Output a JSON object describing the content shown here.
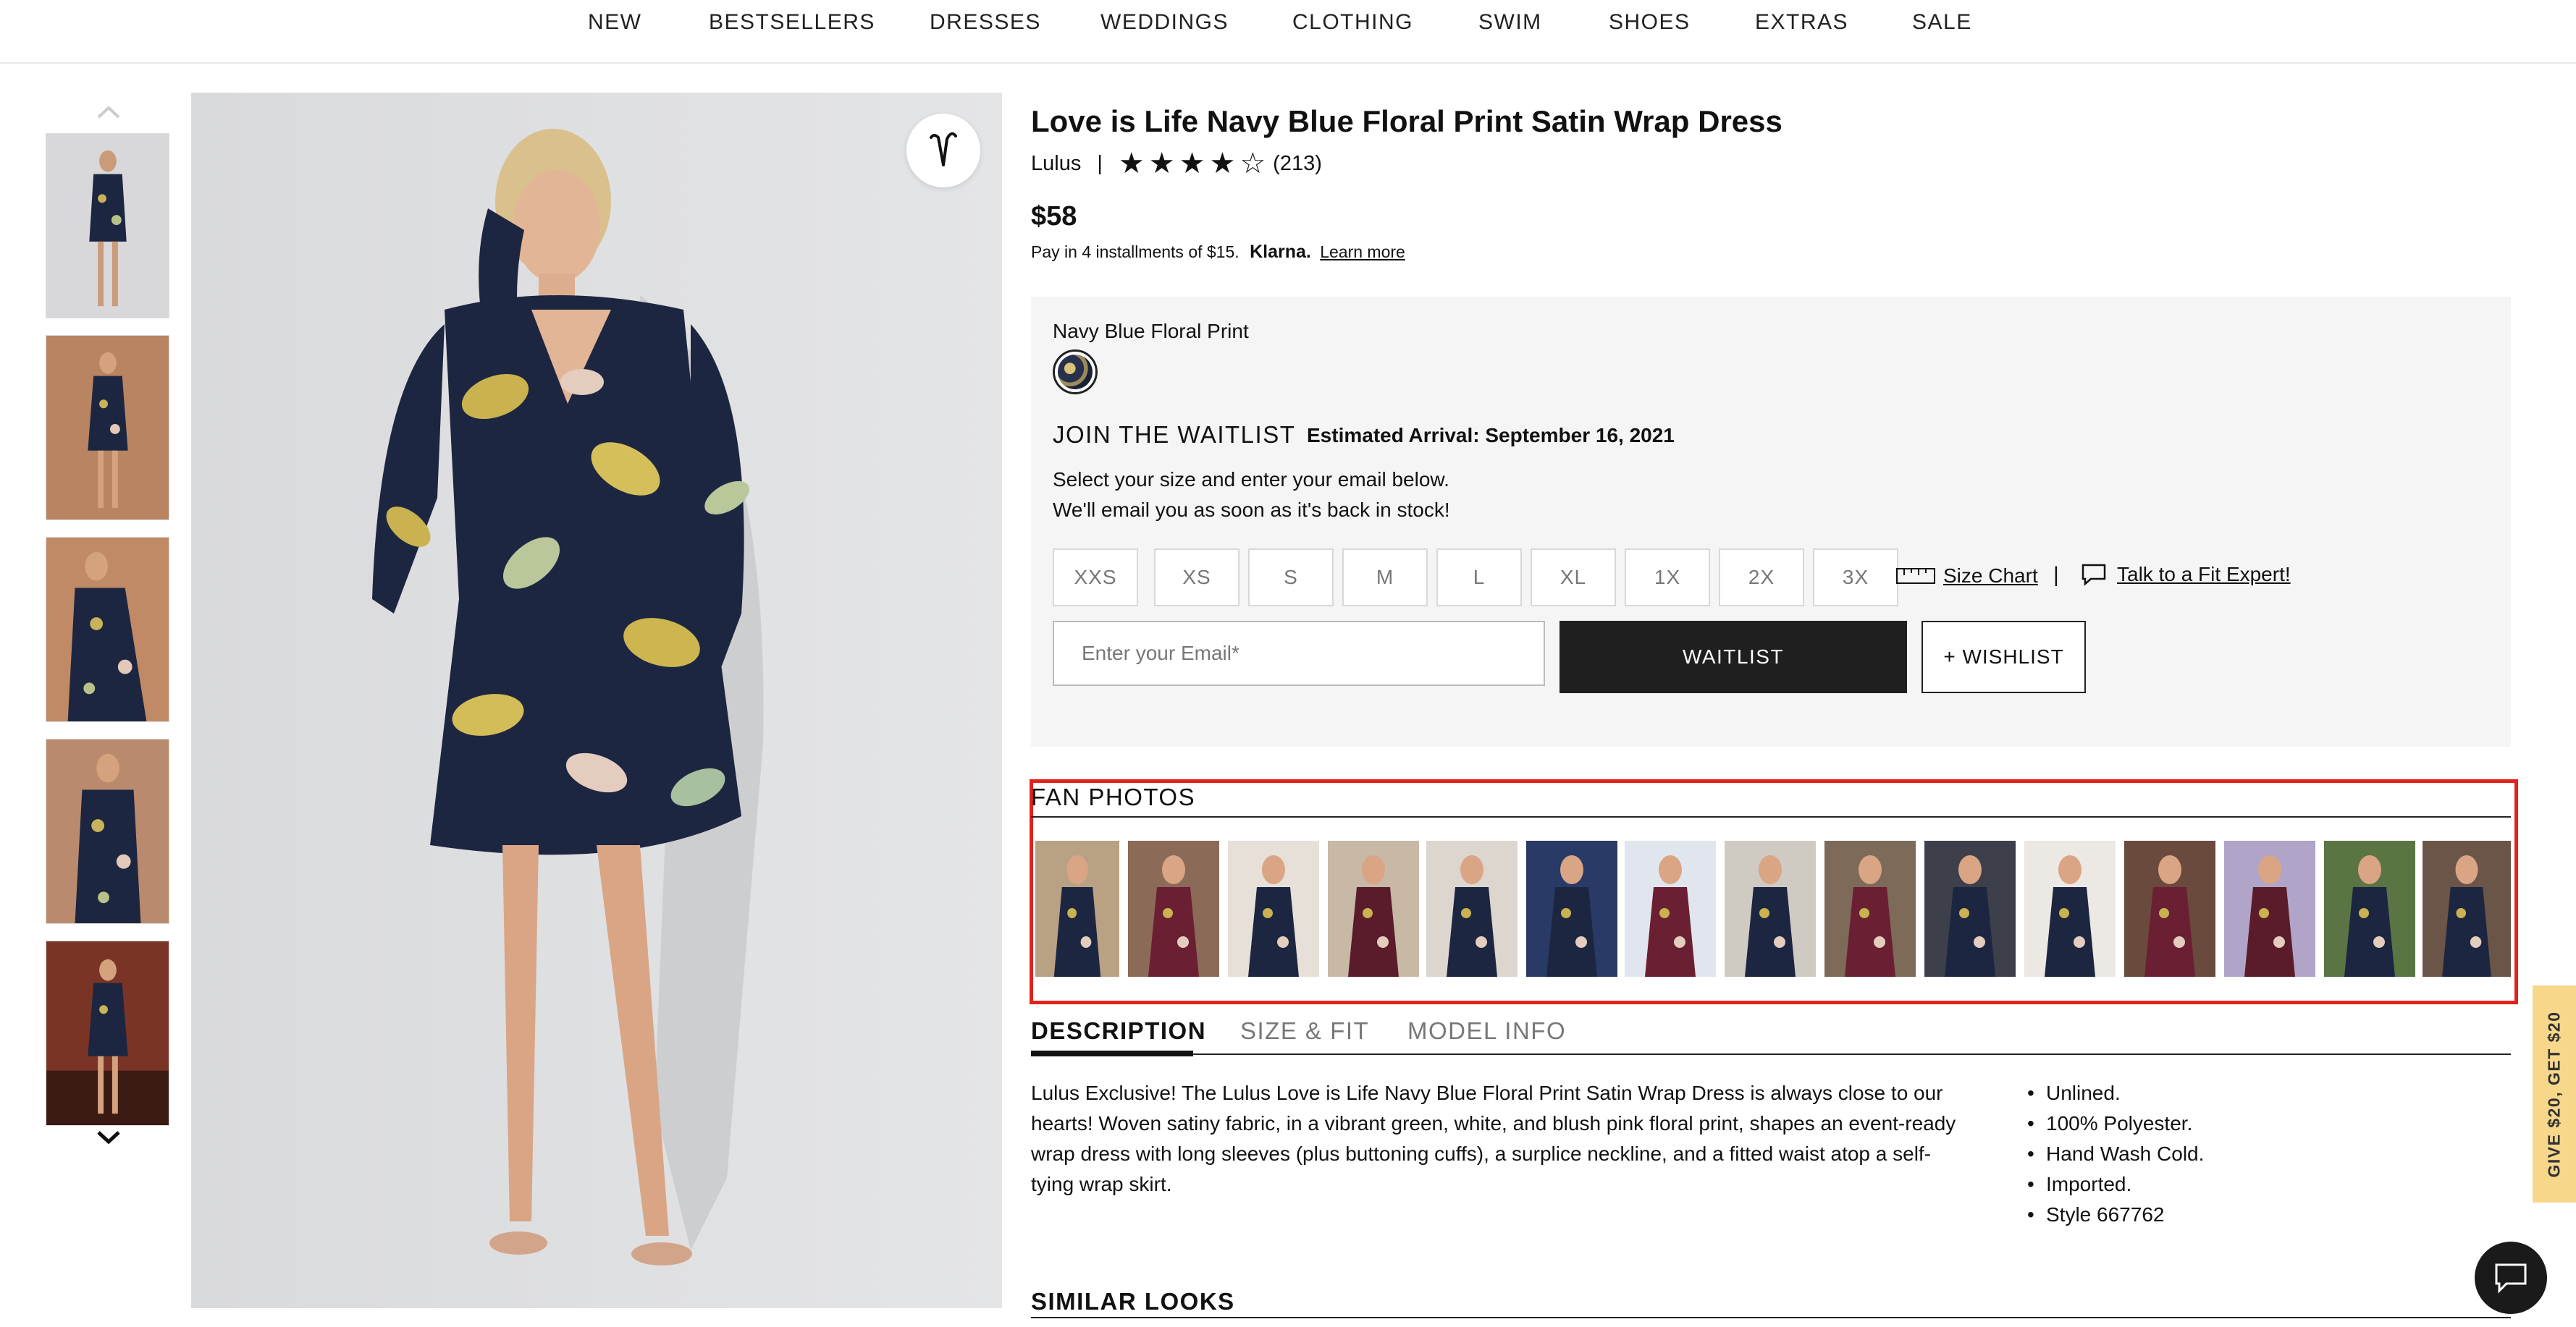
{
  "nav": {
    "items": [
      "NEW",
      "BESTSELLERS",
      "DRESSES",
      "WEDDINGS",
      "CLOTHING",
      "SWIM",
      "SHOES",
      "EXTRAS",
      "SALE"
    ]
  },
  "product": {
    "title": "Love is Life Navy Blue Floral Print Satin Wrap Dress",
    "brand": "Lulus",
    "separator": "|",
    "rating": 4.5,
    "review_count": "(213)",
    "price": "$58",
    "installments_text": "Pay in 4 installments of $15.",
    "klarna": "Klarna.",
    "learn_more": "Learn more"
  },
  "variant": {
    "color_name": "Navy Blue Floral Print",
    "waitlist_heading": "JOIN THE WAITLIST",
    "estimated_arrival": "Estimated Arrival: September 16, 2021",
    "waitlist_line1": "Select your size and enter your email below.",
    "waitlist_line2": "We'll email you as soon as it's back in stock!",
    "sizes": [
      "XXS",
      "XS",
      "S",
      "M",
      "L",
      "XL",
      "1X",
      "2X",
      "3X"
    ],
    "size_chart": "Size Chart",
    "pipe": "|",
    "fit_expert": "Talk to a Fit Expert!",
    "email_placeholder": "Enter your Email*",
    "waitlist_button": "WAITLIST",
    "wishlist_button": "+ WISHLIST"
  },
  "fan_photos": {
    "title": "FAN PHOTOS",
    "photo_count": 15
  },
  "tabs": {
    "description": "DESCRIPTION",
    "size_fit": "SIZE & FIT",
    "model_info": "MODEL INFO",
    "active": "DESCRIPTION"
  },
  "description": {
    "text": "Lulus Exclusive! The Lulus Love is Life Navy Blue Floral Print Satin Wrap Dress is always close to our hearts! Woven satiny fabric, in a vibrant green, white, and blush pink floral print, shapes an event-ready wrap dress with long sleeves (plus buttoning cuffs), a surplice neckline, and a fitted waist atop a self-tying wrap skirt.",
    "bullets": [
      "Unlined.",
      "100% Polyester.",
      "Hand Wash Cold.",
      "Imported.",
      "Style 667762"
    ]
  },
  "similar_looks": "SIMILAR LOOKS",
  "side_tab": "GIVE $20, GET $20",
  "colors": {
    "highlight": "#e3211b",
    "dark_button": "#1f1f1f",
    "panel_bg": "#f5f5f5",
    "side_tab_bg": "#f7d78a",
    "dress_navy": "#1d2640"
  },
  "icons": {
    "wishlist_heart": "heart-icon",
    "chat": "chat-icon",
    "size_chart": "ruler-icon",
    "fit_expert": "speech-bubble-icon",
    "thumb_up": "chevron-up-icon",
    "thumb_down": "chevron-down-icon"
  }
}
